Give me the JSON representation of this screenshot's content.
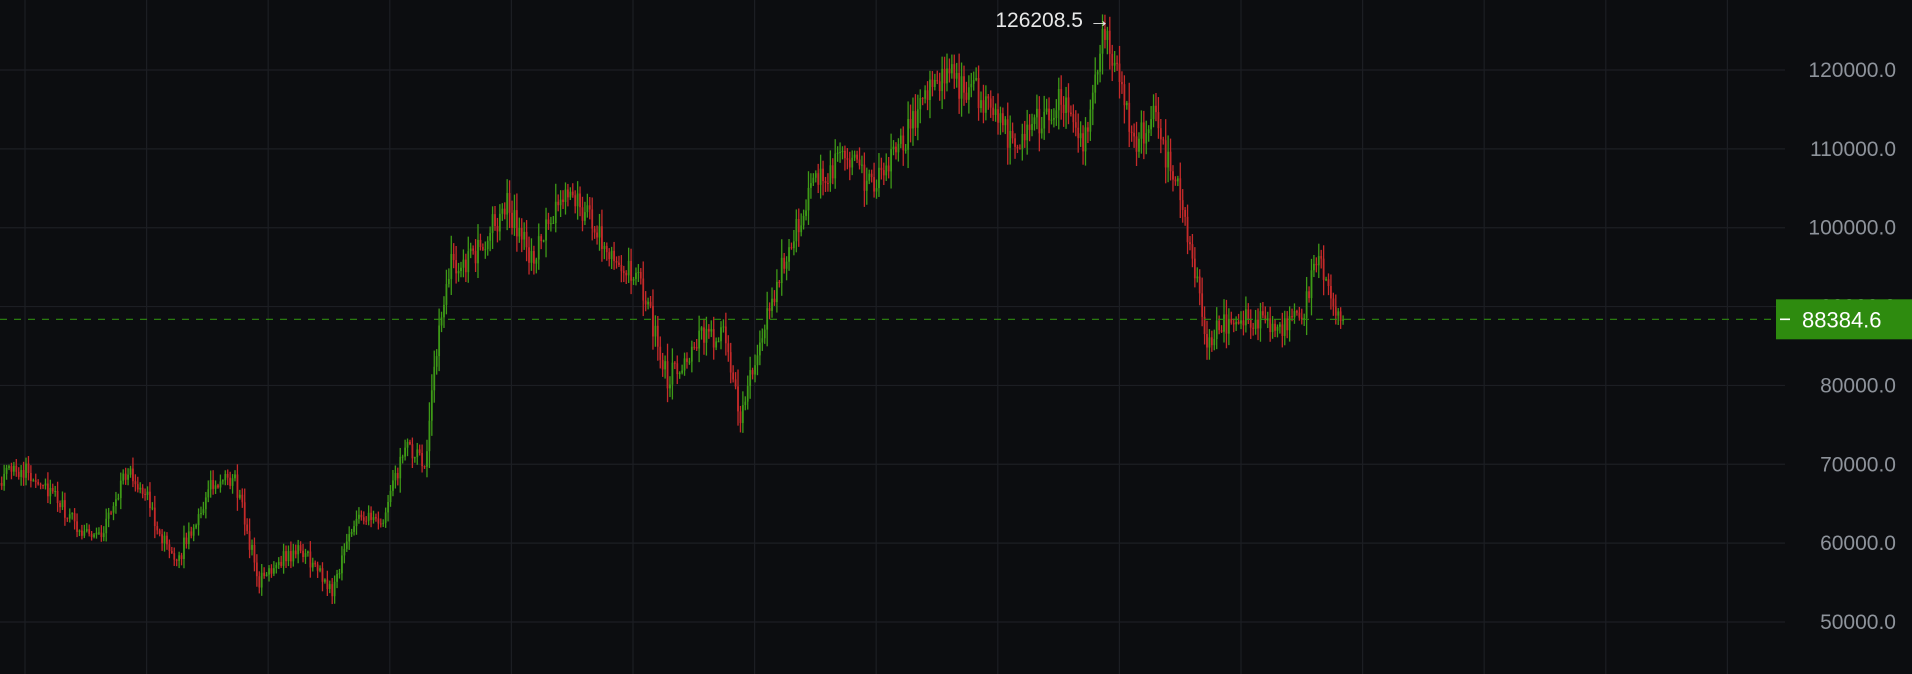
{
  "chart_data": {
    "type": "candlestick",
    "y_axis": {
      "position": "right",
      "ylim": [
        46000,
        131000
      ],
      "tick_labels": [
        "50000.0",
        "60000.0",
        "70000.0",
        "80000.0",
        "90000.0",
        "100000.0",
        "110000.0",
        "120000.0"
      ],
      "ticks": [
        50000,
        60000,
        70000,
        80000,
        90000,
        100000,
        110000,
        120000
      ]
    },
    "grid": true,
    "current_price": {
      "value": 88384.6,
      "label": "88384.6",
      "color": "#2e8b0f"
    },
    "high_marker": {
      "value": 126208.5,
      "label": "126208.5",
      "arrow": "→"
    },
    "colors": {
      "background": "#0c0d10",
      "up": "#3e9a17",
      "down": "#c62a2a",
      "grid": "#1c1e23",
      "axis_text": "#8e939b"
    },
    "candle_count": 400,
    "close_anchors": [
      [
        0,
        65000
      ],
      [
        8,
        70000
      ],
      [
        20,
        68000
      ],
      [
        35,
        62000
      ],
      [
        45,
        61000
      ],
      [
        55,
        69000
      ],
      [
        62,
        67000
      ],
      [
        75,
        57000
      ],
      [
        90,
        67000
      ],
      [
        100,
        68000
      ],
      [
        110,
        55000
      ],
      [
        118,
        58000
      ],
      [
        128,
        59000
      ],
      [
        140,
        54000
      ],
      [
        150,
        64000
      ],
      [
        160,
        62000
      ],
      [
        170,
        72000
      ],
      [
        178,
        70000
      ],
      [
        183,
        84000
      ],
      [
        188,
        95000
      ],
      [
        198,
        96000
      ],
      [
        212,
        103000
      ],
      [
        222,
        96000
      ],
      [
        238,
        105000
      ],
      [
        250,
        99000
      ],
      [
        268,
        92000
      ],
      [
        278,
        81000
      ],
      [
        292,
        86000
      ],
      [
        302,
        86000
      ],
      [
        308,
        76000
      ],
      [
        315,
        84000
      ],
      [
        330,
        100000
      ],
      [
        342,
        107000
      ],
      [
        352,
        109000
      ],
      [
        362,
        105000
      ],
      [
        374,
        110000
      ],
      [
        385,
        118000
      ],
      [
        395,
        119000
      ],
      [
        410,
        116000
      ],
      [
        420,
        111000
      ],
      [
        440,
        116000
      ],
      [
        450,
        111000
      ],
      [
        458,
        125000
      ],
      [
        464,
        119000
      ],
      [
        470,
        110000
      ],
      [
        478,
        114000
      ],
      [
        490,
        103000
      ],
      [
        500,
        86000
      ],
      [
        512,
        89000
      ],
      [
        522,
        88000
      ],
      [
        532,
        87000
      ],
      [
        540,
        90000
      ],
      [
        546,
        96000
      ],
      [
        552,
        90000
      ],
      [
        556,
        88384.6
      ]
    ]
  }
}
